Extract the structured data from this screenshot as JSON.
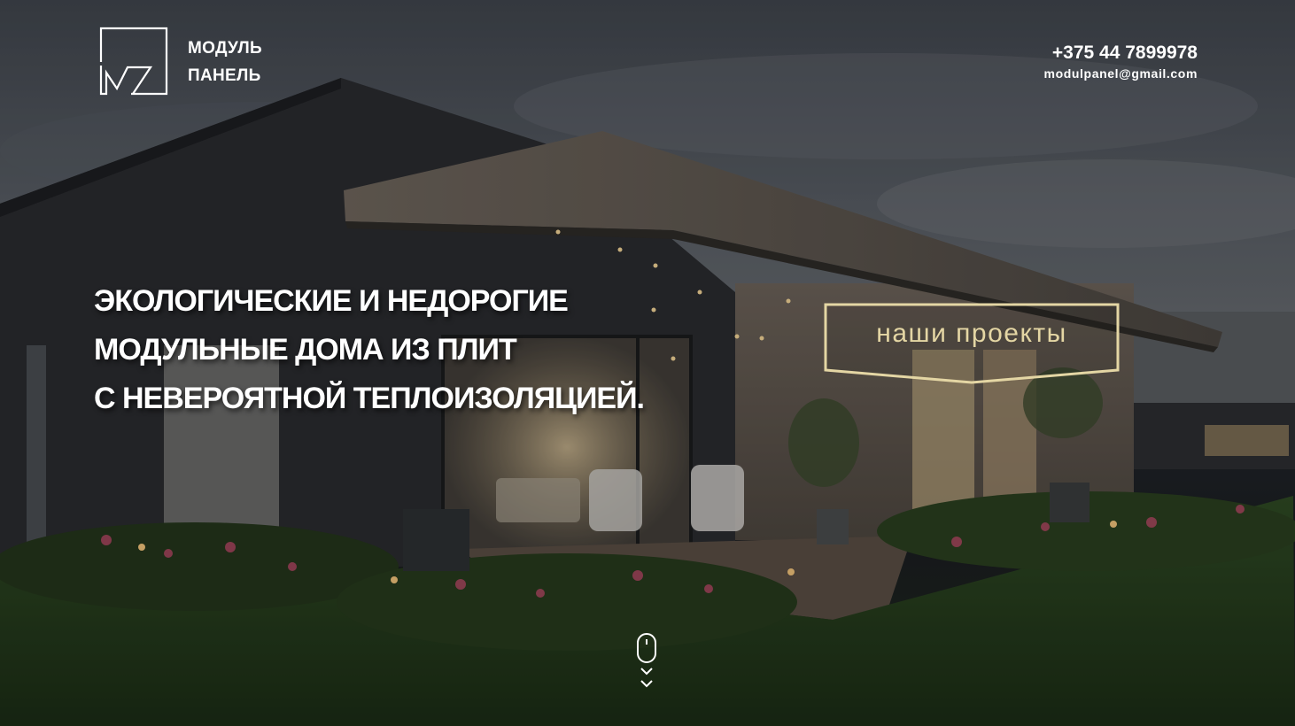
{
  "header": {
    "logo": {
      "line1": "МОДУЛЬ",
      "line2": "ПАНЕЛЬ",
      "icon": "modul-panel-logo-icon"
    },
    "contacts": {
      "phone": "+375 44 7899978",
      "email": "modulpanel@gmail.com"
    }
  },
  "hero": {
    "headline": [
      "ЭКОЛОГИЧЕСКИЕ И НЕДОРОГИЕ",
      "МОДУЛЬНЫЕ ДОМА ИЗ ПЛИТ",
      "С НЕВЕРОЯТНОЙ ТЕПЛОИЗОЛЯЦИЕЙ."
    ],
    "cta_label": "наши проекты",
    "scroll_icon": "mouse-scroll-down-icon"
  },
  "colors": {
    "accent": "#e4d6a4",
    "text": "#ffffff"
  }
}
